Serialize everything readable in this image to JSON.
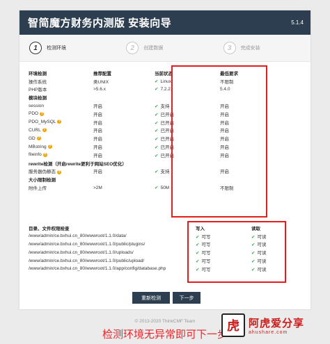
{
  "header": {
    "title": "智简魔方财务内测版 安装向导",
    "version": "5.1.4"
  },
  "steps": [
    {
      "num": "1",
      "label": "检测环境"
    },
    {
      "num": "2",
      "label": "创建数据"
    },
    {
      "num": "3",
      "label": "完成安装"
    }
  ],
  "env_table": {
    "headers": [
      "环境检测",
      "推荐配置",
      "当前状态",
      "最低要求"
    ],
    "rows": [
      {
        "type": "row",
        "name": "操作系统",
        "recommended": "类UNIX",
        "current": "Linux",
        "check": true,
        "minimum": "不限制"
      },
      {
        "type": "row",
        "name": "PHP版本",
        "recommended": ">5.6.x",
        "current": "7.2.21",
        "check": true,
        "minimum": "5.4.0"
      },
      {
        "type": "section",
        "name": "模块检测"
      },
      {
        "type": "row",
        "name": "session",
        "recommended": "开启",
        "current": "支持",
        "check": true,
        "minimum": "开启"
      },
      {
        "type": "row",
        "name": "PDO",
        "help": true,
        "recommended": "开启",
        "current": "已开启",
        "check": true,
        "minimum": "开启"
      },
      {
        "type": "row",
        "name": "PDO_MySQL",
        "help": true,
        "recommended": "开启",
        "current": "已开启",
        "check": true,
        "minimum": "开启"
      },
      {
        "type": "row",
        "name": "CURL",
        "help": true,
        "recommended": "开启",
        "current": "已开启",
        "check": true,
        "minimum": "开启"
      },
      {
        "type": "row",
        "name": "GD",
        "help": true,
        "recommended": "开启",
        "current": "已开启",
        "check": true,
        "minimum": "开启"
      },
      {
        "type": "row",
        "name": "MBstring",
        "help": true,
        "recommended": "开启",
        "current": "已开启",
        "check": true,
        "minimum": "开启"
      },
      {
        "type": "row",
        "name": "fileinfo",
        "help": true,
        "recommended": "开启",
        "current": "已开启",
        "check": true,
        "minimum": "开启"
      },
      {
        "type": "section",
        "name": "rewrite检测（开启rewrite更利于网站SEO优化）"
      },
      {
        "type": "row",
        "name": "服务器伪静态",
        "help": true,
        "recommended": "开启",
        "current": "支持",
        "check": true,
        "minimum": "开启"
      },
      {
        "type": "section",
        "name": "大小限制检测"
      },
      {
        "type": "row",
        "name": "附件上传",
        "recommended": ">2M",
        "current": "50M",
        "check": true,
        "minimum": "不限制"
      }
    ]
  },
  "dir_table": {
    "headers": [
      "目录、文件权限检查",
      "写入",
      "读取"
    ],
    "rows": [
      {
        "path": "/www/admin/ce.bxhui.cn_80/wwwroot/1.1.0/data/",
        "write": "可写",
        "read": "可读"
      },
      {
        "path": "/www/admin/ce.bxhui.cn_80/wwwroot/1.1.0/public/plugins/",
        "write": "可写",
        "read": "可读"
      },
      {
        "path": "/www/admin/ce.bxhui.cn_80/wwwroot/1.1.0/uploads/",
        "write": "可写",
        "read": "可读"
      },
      {
        "path": "/www/admin/ce.bxhui.cn_80/wwwroot/1.1.0/public/upload/",
        "write": "可写",
        "read": "可读"
      },
      {
        "path": "/www/admin/ce.bxhui.cn_80/wwwroot/1.1.0/app/config/database.php",
        "write": "可写",
        "read": "可读"
      }
    ]
  },
  "buttons": {
    "recheck": "重新检测",
    "next": "下一步"
  },
  "footer": "© 2013-2020 ThinkCMF Team",
  "caption": "检测环境无异常即可下一步",
  "watermark": {
    "seal": "虎",
    "cn": "阿虎爱分享",
    "en": "ahushare.com"
  },
  "colors": {
    "header_bg": "#2c3e50",
    "check": "#2fa852",
    "highlight": "#e41c1c",
    "caption": "#e8262b"
  }
}
